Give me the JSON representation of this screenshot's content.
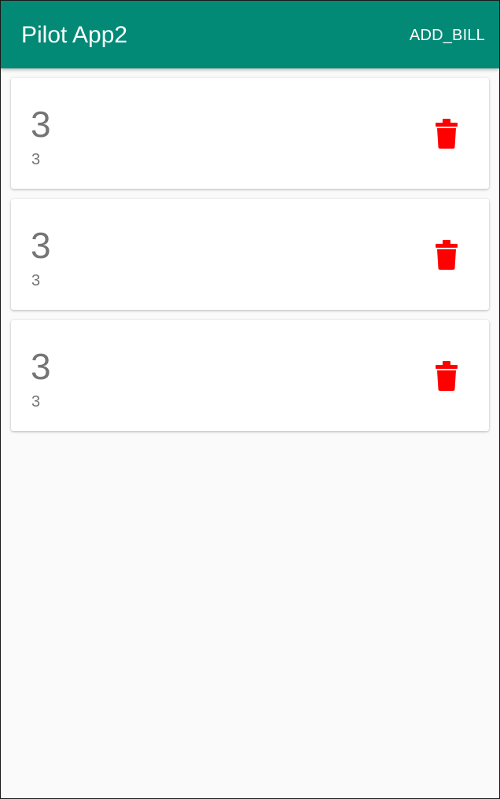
{
  "app_bar": {
    "title": "Pilot App2",
    "action_label": "ADD_BILL",
    "color": "#028a76"
  },
  "bills": [
    {
      "title": "3",
      "subtitle": "3",
      "delete_icon": "trash-icon"
    },
    {
      "title": "3",
      "subtitle": "3",
      "delete_icon": "trash-icon"
    },
    {
      "title": "3",
      "subtitle": "3",
      "delete_icon": "trash-icon"
    }
  ],
  "colors": {
    "delete_icon": "#ff0000",
    "background": "#fafafa",
    "text_secondary": "#757575"
  }
}
